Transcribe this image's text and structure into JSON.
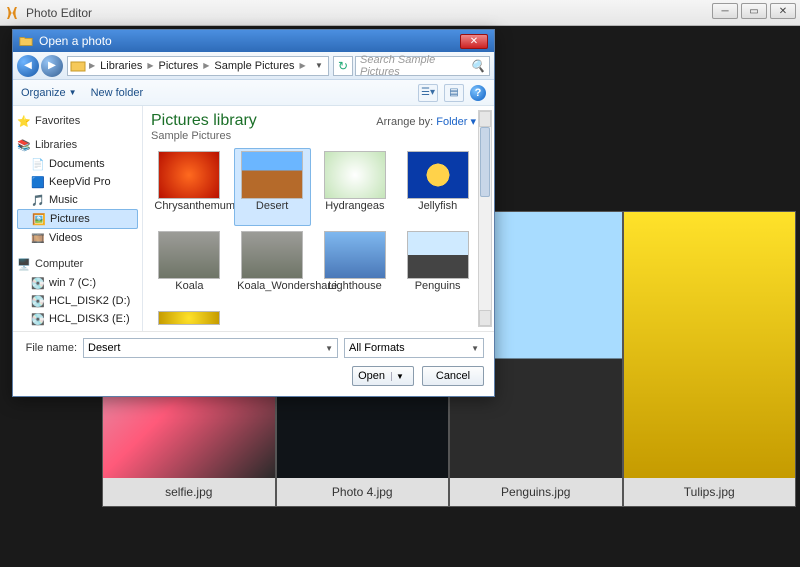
{
  "app": {
    "title": "Photo Editor"
  },
  "strip": [
    {
      "caption": "selfie.jpg",
      "class": "big-selfie"
    },
    {
      "caption": "Photo 4.jpg",
      "class": "big-photo4"
    },
    {
      "caption": "Penguins.jpg",
      "class": "big-peng"
    },
    {
      "caption": "Tulips.jpg",
      "class": "big-tulip"
    }
  ],
  "dialog": {
    "title": "Open a photo",
    "breadcrumbs": [
      "Libraries",
      "Pictures",
      "Sample Pictures"
    ],
    "search_placeholder": "Search Sample Pictures",
    "toolbar": {
      "organize": "Organize",
      "new_folder": "New folder"
    },
    "library": {
      "title": "Pictures library",
      "subtitle": "Sample Pictures",
      "arrange_label": "Arrange by:",
      "arrange_value": "Folder"
    },
    "tree": {
      "favorites": "Favorites",
      "libraries": "Libraries",
      "lib_items": [
        "Documents",
        "KeepVid Pro",
        "Music",
        "Pictures",
        "Videos"
      ],
      "lib_selected": "Pictures",
      "computer": "Computer",
      "drives": [
        "win 7 (C:)",
        "HCL_DISK2 (D:)",
        "HCL_DISK3 (E:)"
      ]
    },
    "items": [
      {
        "label": "Chrysanthemum",
        "class": "t-red"
      },
      {
        "label": "Desert",
        "class": "t-desert",
        "selected": true
      },
      {
        "label": "Hydrangeas",
        "class": "t-white"
      },
      {
        "label": "Jellyfish",
        "class": "t-jelly"
      },
      {
        "label": "Koala",
        "class": "t-koala"
      },
      {
        "label": "Koala_Wondershare",
        "class": "t-koala"
      },
      {
        "label": "Lighthouse",
        "class": "t-light"
      },
      {
        "label": "Penguins",
        "class": "t-peng"
      }
    ],
    "partial_item_class": "t-tulip",
    "file_name_label": "File name:",
    "file_name_value": "Desert",
    "format_filter": "All Formats",
    "open_label": "Open",
    "cancel_label": "Cancel"
  }
}
